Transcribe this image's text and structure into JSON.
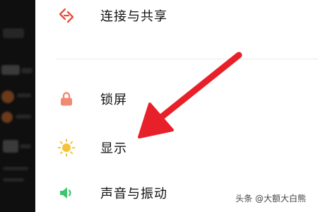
{
  "settings": {
    "items": [
      {
        "label": "连接与共享",
        "icon": "connection-sharing-icon"
      },
      {
        "label": "锁屏",
        "icon": "lock-icon"
      },
      {
        "label": "显示",
        "icon": "sun-icon"
      },
      {
        "label": "声音与振动",
        "icon": "speaker-icon"
      }
    ]
  },
  "colors": {
    "connection_icon": "#e8503a",
    "lock_icon": "#f08a73",
    "sun_icon": "#f5c23a",
    "speaker_icon": "#3cc66b",
    "annotation_arrow": "#e8202a"
  },
  "watermark": {
    "text": "头条 @大额大白熊"
  }
}
